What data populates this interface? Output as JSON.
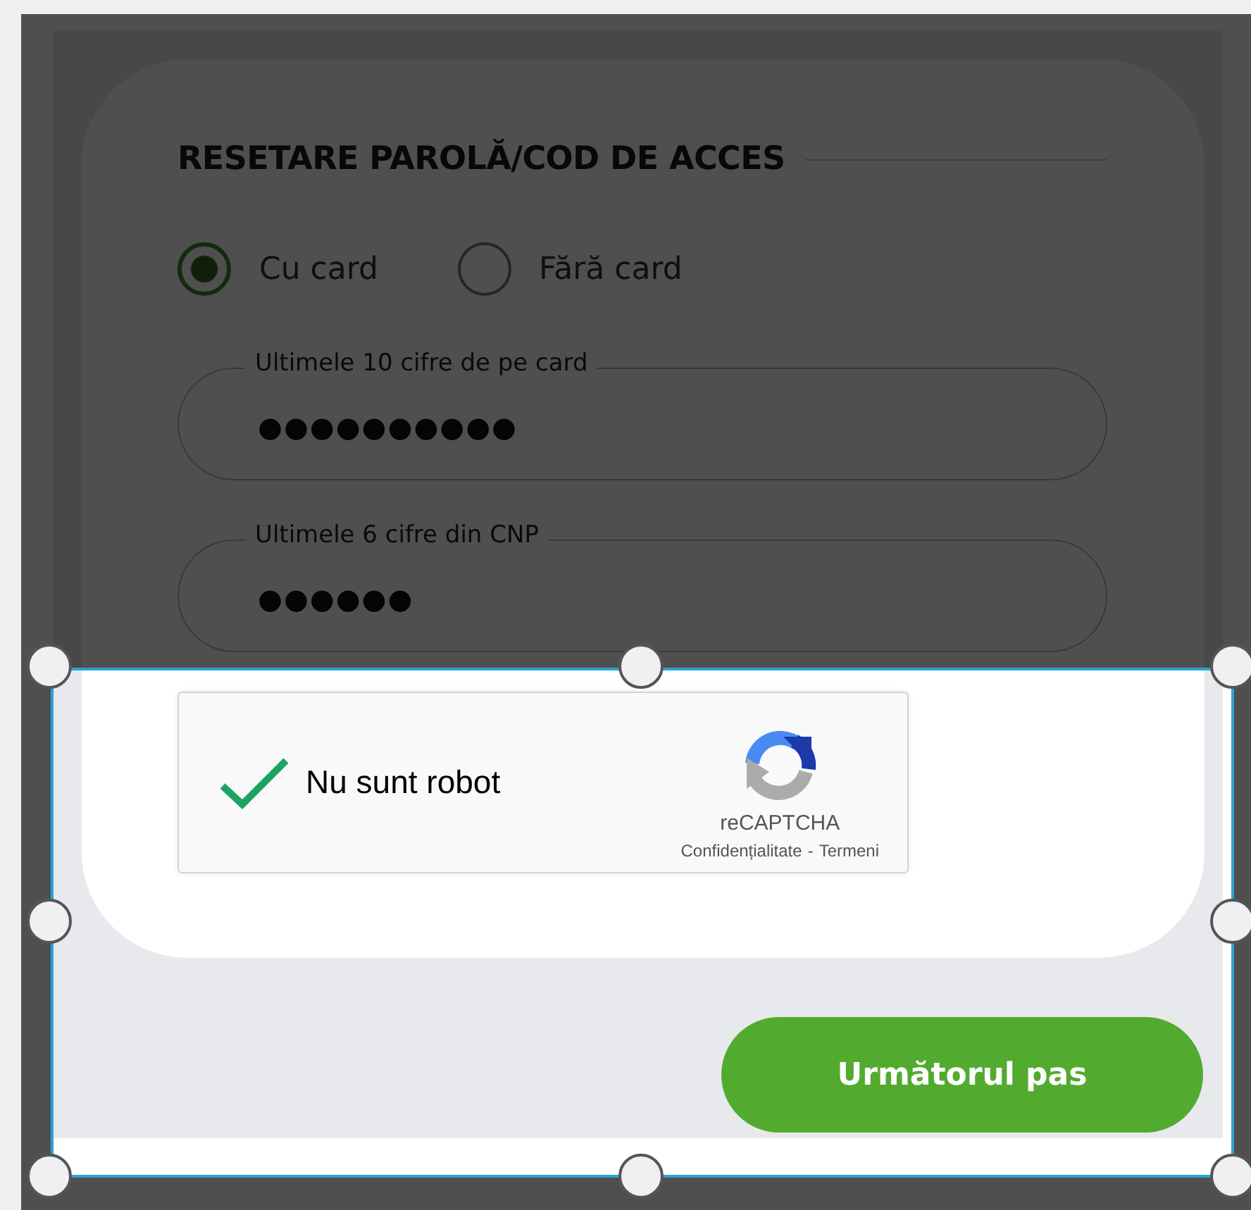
{
  "heading": "RESETARE PAROLĂ/COD DE ACCES",
  "options": [
    {
      "label": "Cu card",
      "selected": true
    },
    {
      "label": "Fără card",
      "selected": false
    }
  ],
  "fields": [
    {
      "label": "Ultimele 10 cifre de pe card",
      "value": "●●●●●●●●●●"
    },
    {
      "label": "Ultimele 6 cifre din CNP",
      "value": "●●●●●●"
    }
  ],
  "captcha": {
    "checked": true,
    "label": "Nu sunt robot",
    "brand": "reCAPTCHA",
    "privacy": "Confidențialitate",
    "separator": "-",
    "terms": "Termeni"
  },
  "next_button": "Următorul pas"
}
